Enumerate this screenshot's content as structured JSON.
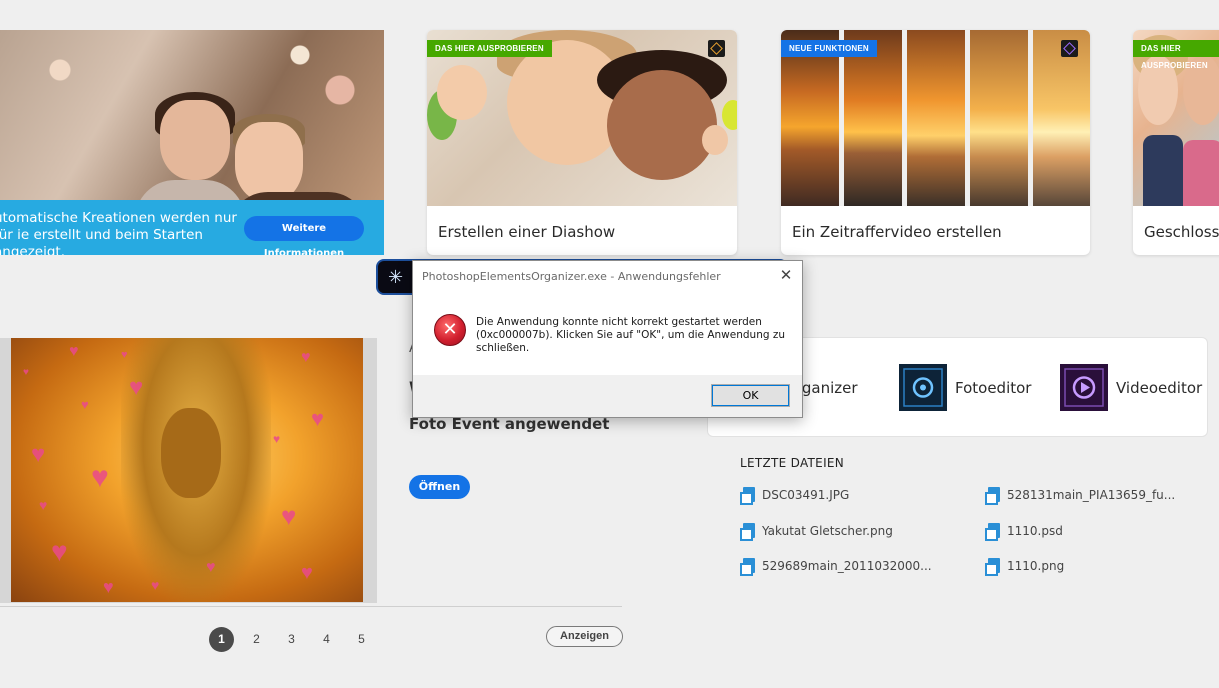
{
  "hero": {
    "banner_text": "utomatische Kreationen werden nur für ie erstellt und beim Starten angezeigt.",
    "more_button": "Weitere Informationen"
  },
  "cards": [
    {
      "badge": "DAS HIER AUSPROBIEREN",
      "badge_color": "#46a800",
      "caption": "Erstellen einer Diashow",
      "icon": "organizer-icon"
    },
    {
      "badge": "NEUE FUNKTIONEN",
      "badge_color": "#1473e6",
      "caption": "Ein Zeitraffervideo erstellen",
      "icon": "premiere-icon"
    },
    {
      "badge": "DAS HIER AUSPROBIEREN",
      "badge_color": "#46a800",
      "caption": "Geschlossen"
    }
  ],
  "event": {
    "stub1": "A",
    "stub2": "W",
    "subtitle": "Foto Event angewendet",
    "open_button": "Öffnen"
  },
  "pager": {
    "pages": [
      "1",
      "2",
      "3",
      "4",
      "5"
    ],
    "active": "1",
    "show_button": "Anzeigen"
  },
  "launcher": {
    "apps": [
      {
        "label": "rganizer"
      },
      {
        "label": "Fotoeditor",
        "icon": "fotoeditor-icon"
      },
      {
        "label": "Videoeditor",
        "icon": "videoeditor-icon"
      }
    ]
  },
  "recent": {
    "title": "LETZTE DATEIEN",
    "files": [
      "DSC03491.JPG",
      "528131main_PIA13659_fu...",
      "Yakutat Gletscher.png",
      "1110.psd",
      "529689main_2011032000...",
      "1110.png"
    ]
  },
  "dialog": {
    "title": "PhotoshopElementsOrganizer.exe - Anwendungsfehler",
    "message": "Die Anwendung konnte nicht korrekt gestartet werden (0xc000007b). Klicken Sie auf \"OK\", um die Anwendung zu schließen.",
    "ok_button": "OK",
    "close_glyph": "✕",
    "error_glyph": "✕"
  },
  "colors": {
    "accent": "#1473e6",
    "banner": "#27aae1",
    "badge_green": "#46a800"
  }
}
